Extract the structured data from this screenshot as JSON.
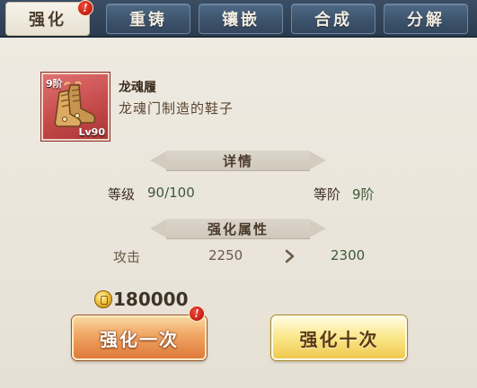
{
  "tabs": [
    {
      "label": "强化",
      "active": true,
      "badge": "!"
    },
    {
      "label": "重铸",
      "active": false
    },
    {
      "label": "镶嵌",
      "active": false
    },
    {
      "label": "合成",
      "active": false
    },
    {
      "label": "分解",
      "active": false
    }
  ],
  "item": {
    "tier": "9阶",
    "level": "Lv90",
    "name": "龙魂履",
    "description": "龙魂门制造的鞋子",
    "icon": "boots-icon",
    "rarity_color": "#c44848"
  },
  "details": {
    "title": "详情",
    "level_label": "等级",
    "level_value": "90/100",
    "rank_label": "等阶",
    "rank_value": "9阶"
  },
  "enhance": {
    "title": "强化属性",
    "stat_label": "攻击",
    "current": "2250",
    "next": "2300"
  },
  "cost": {
    "currency_icon": "gold-coin-icon",
    "amount": "180000"
  },
  "buttons": {
    "once": "强化一次",
    "once_badge": "!",
    "ten": "强化十次"
  }
}
